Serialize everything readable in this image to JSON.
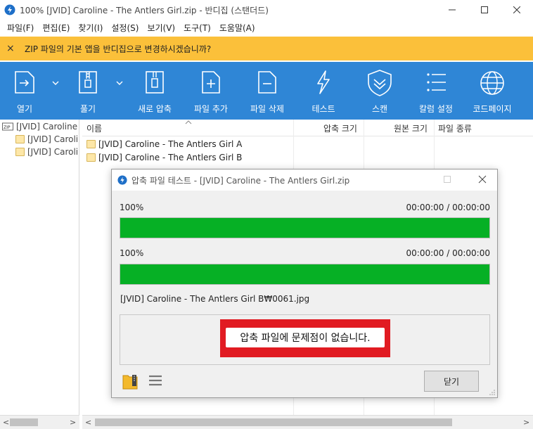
{
  "window": {
    "title": "100% [JVID] Caroline - The Antlers Girl.zip - 반디집 (스탠더드)"
  },
  "menu": [
    "파일(F)",
    "편집(E)",
    "찾기(I)",
    "설정(S)",
    "보기(V)",
    "도구(T)",
    "도움말(A)"
  ],
  "notice": {
    "message": "ZIP 파일의 기본 앱을 반디집으로 변경하시겠습니까?",
    "close": "×"
  },
  "toolbar": {
    "open": "열기",
    "extract": "풀기",
    "new_archive": "새로 압축",
    "add_file": "파일 추가",
    "delete_file": "파일 삭제",
    "test": "테스트",
    "scan": "스캔",
    "columns": "칼럼 설정",
    "codepage": "코드페이지"
  },
  "tree": {
    "root": "[JVID] Caroline - The Antlers Girl.zip",
    "children": [
      "[JVID] Caroline - The Antlers Girl A",
      "[JVID] Caroline - The Antlers Girl B"
    ]
  },
  "filelist": {
    "columns": [
      "이름",
      "압축 크기",
      "원본 크기",
      "파일 종류"
    ],
    "rows": [
      "[JVID] Caroline - The Antlers Girl A",
      "[JVID] Caroline - The Antlers Girl B"
    ]
  },
  "dialog": {
    "title": "압축 파일 테스트 - [JVID] Caroline - The Antlers Girl.zip",
    "progress1": {
      "label": "100%",
      "time": "00:00:00 / 00:00:00",
      "value": 1.0
    },
    "progress2": {
      "label": "100%",
      "time": "00:00:00 / 00:00:00",
      "value": 1.0
    },
    "current_file": "[JVID] Caroline - The Antlers Girl B₩0061.jpg",
    "result": "압축 파일에 문제점이 없습니다.",
    "close_button": "닫기"
  },
  "colors": {
    "toolbar": "#2f86d6",
    "notice": "#fbc03a",
    "progress": "#06b025",
    "highlight": "#e11b22"
  }
}
